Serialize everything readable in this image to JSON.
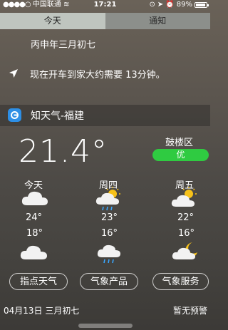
{
  "status_bar": {
    "carrier": "中国联通",
    "network": "中国联通",
    "time": "17:21",
    "battery": "89%"
  },
  "tabs": [
    {
      "label": "今天",
      "active": true
    },
    {
      "label": "通知",
      "active": false
    }
  ],
  "today": {
    "lunar_date": "丙申年三月初七",
    "commute": "现在开车到家大约需要 13分钟。"
  },
  "widget": {
    "title": "知天气-福建",
    "current_temp": "21.4°",
    "location": "鼓楼区",
    "aqi": "优",
    "aqi_color": "#2fcb41",
    "forecast": [
      {
        "day": "今天",
        "high": "24°",
        "low": "18°",
        "day_icon": "cloud-icon",
        "night_icon": "cloud-icon"
      },
      {
        "day": "周四",
        "high": "23°",
        "low": "16°",
        "day_icon": "sun-cloud-rain-icon",
        "night_icon": "cloud-rain-icon"
      },
      {
        "day": "周五",
        "high": "22°",
        "low": "16°",
        "day_icon": "sun-cloud-icon",
        "night_icon": "moon-cloud-icon"
      }
    ],
    "buttons": [
      "指点天气",
      "气象产品",
      "气象服务"
    ],
    "footer_date": "04月13日 三月初七",
    "footer_alert": "暂无预警"
  }
}
